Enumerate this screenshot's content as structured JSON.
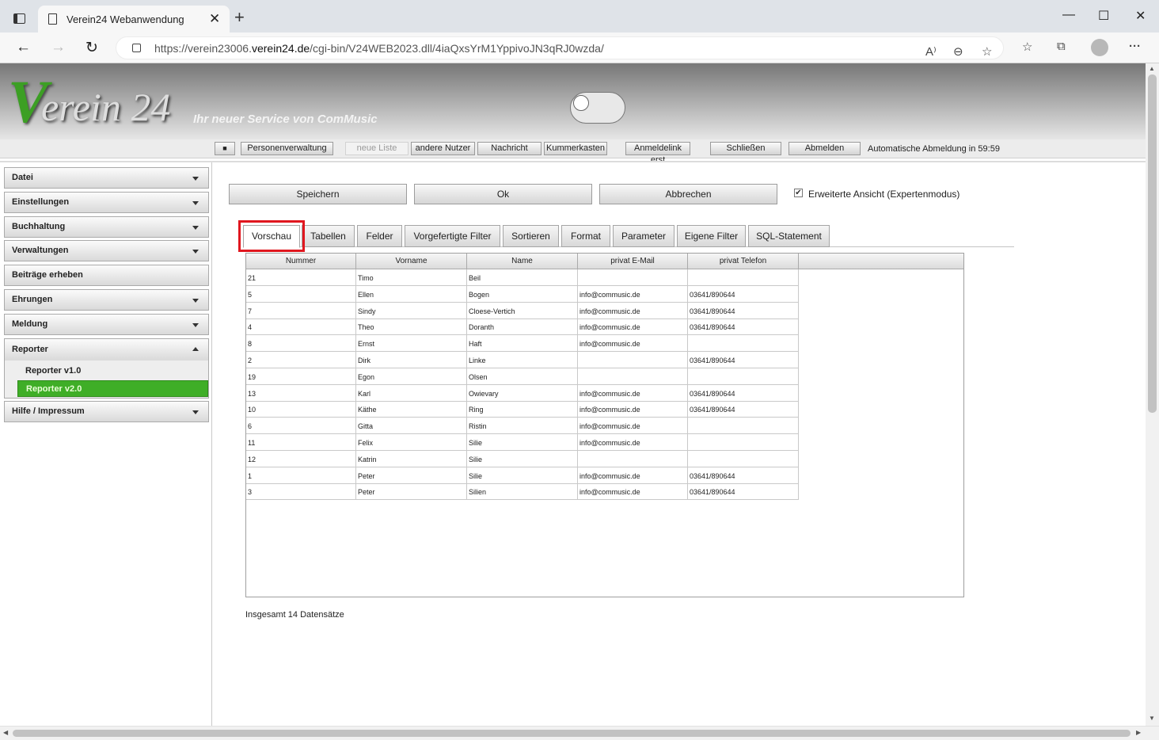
{
  "browser": {
    "tab_title": "Verein24 Webanwendung",
    "url_prefix": "https://verein23006.",
    "url_domain": "verein24.de",
    "url_path": "/cgi-bin/V24WEB2023.dll/4iaQxsYrM1YppivoJN3qRJ0wzda/"
  },
  "banner": {
    "logo_v": "V",
    "logo_rest": "erein 24",
    "slogan": "Ihr neuer Service von ComMusic"
  },
  "toolbar": {
    "stop": "■",
    "personenverwaltung": "Personenverwaltung",
    "neue_liste": "neue Liste",
    "andere_nutzer": "andere Nutzer",
    "nachricht": "Nachricht",
    "kummerkasten": "Kummerkasten",
    "anmeldelink": "Anmeldelink erst",
    "schliessen": "Schließen",
    "abmelden": "Abmelden",
    "auto_logout": "Automatische Abmeldung in 59:59"
  },
  "sidebar": {
    "items": [
      {
        "label": "Datei"
      },
      {
        "label": "Einstellungen"
      },
      {
        "label": "Buchhaltung"
      },
      {
        "label": "Verwaltungen"
      },
      {
        "label": "Beiträge erheben"
      },
      {
        "label": "Ehrungen"
      },
      {
        "label": "Meldung"
      }
    ],
    "reporter": {
      "label": "Reporter",
      "sub": [
        "Reporter v1.0",
        "Reporter v2.0"
      ]
    },
    "hilfe": "Hilfe / Impressum"
  },
  "actions": {
    "speichern": "Speichern",
    "ok": "Ok",
    "abbrechen": "Abbrechen",
    "expert_mode": "Erweiterte Ansicht (Expertenmodus)",
    "expert_checked": "✔"
  },
  "tabs": [
    "Vorschau",
    "Tabellen",
    "Felder",
    "Vorgefertigte Filter",
    "Sortieren",
    "Format",
    "Parameter",
    "Eigene Filter",
    "SQL-Statement"
  ],
  "table": {
    "columns": [
      "Nummer",
      "Vorname",
      "Name",
      "privat E-Mail",
      "privat Telefon"
    ],
    "rows": [
      [
        "21",
        "Timo",
        "Beil",
        "",
        ""
      ],
      [
        "5",
        "Ellen",
        "Bogen",
        "info@commusic.de",
        "03641/890644"
      ],
      [
        "7",
        "Sindy",
        "Cloese-Vertich",
        "info@commusic.de",
        "03641/890644"
      ],
      [
        "4",
        "Theo",
        "Doranth",
        "info@commusic.de",
        "03641/890644"
      ],
      [
        "8",
        "Ernst",
        "Haft",
        "info@commusic.de",
        ""
      ],
      [
        "2",
        "Dirk",
        "Linke",
        "",
        "03641/890644"
      ],
      [
        "19",
        "Egon",
        "Olsen",
        "",
        ""
      ],
      [
        "13",
        "Karl",
        "Owievary",
        "info@commusic.de",
        "03641/890644"
      ],
      [
        "10",
        "Käthe",
        "Ring",
        "info@commusic.de",
        "03641/890644"
      ],
      [
        "6",
        "Gitta",
        "Ristin",
        "info@commusic.de",
        ""
      ],
      [
        "11",
        "Felix",
        "Silie",
        "info@commusic.de",
        ""
      ],
      [
        "12",
        "Katrin",
        "Silie",
        "",
        ""
      ],
      [
        "1",
        "Peter",
        "Silie",
        "info@commusic.de",
        "03641/890644"
      ],
      [
        "3",
        "Peter",
        "Silien",
        "info@commusic.de",
        "03641/890644"
      ]
    ]
  },
  "total": "Insgesamt 14 Datensätze",
  "icons": {
    "tab_close": "✕",
    "new_tab": "+",
    "minimize": "—",
    "maximize": "☐",
    "close": "✕",
    "back": "←",
    "forward": "→",
    "reload": "↻",
    "read_aloud": "A⁾",
    "zoom": "⊖",
    "fav_add": "☆",
    "favorites": "☆",
    "collections": "⧉",
    "menu": "···",
    "scroll_up": "▲",
    "scroll_down": "▼",
    "scroll_left": "◀",
    "scroll_right": "▶"
  }
}
